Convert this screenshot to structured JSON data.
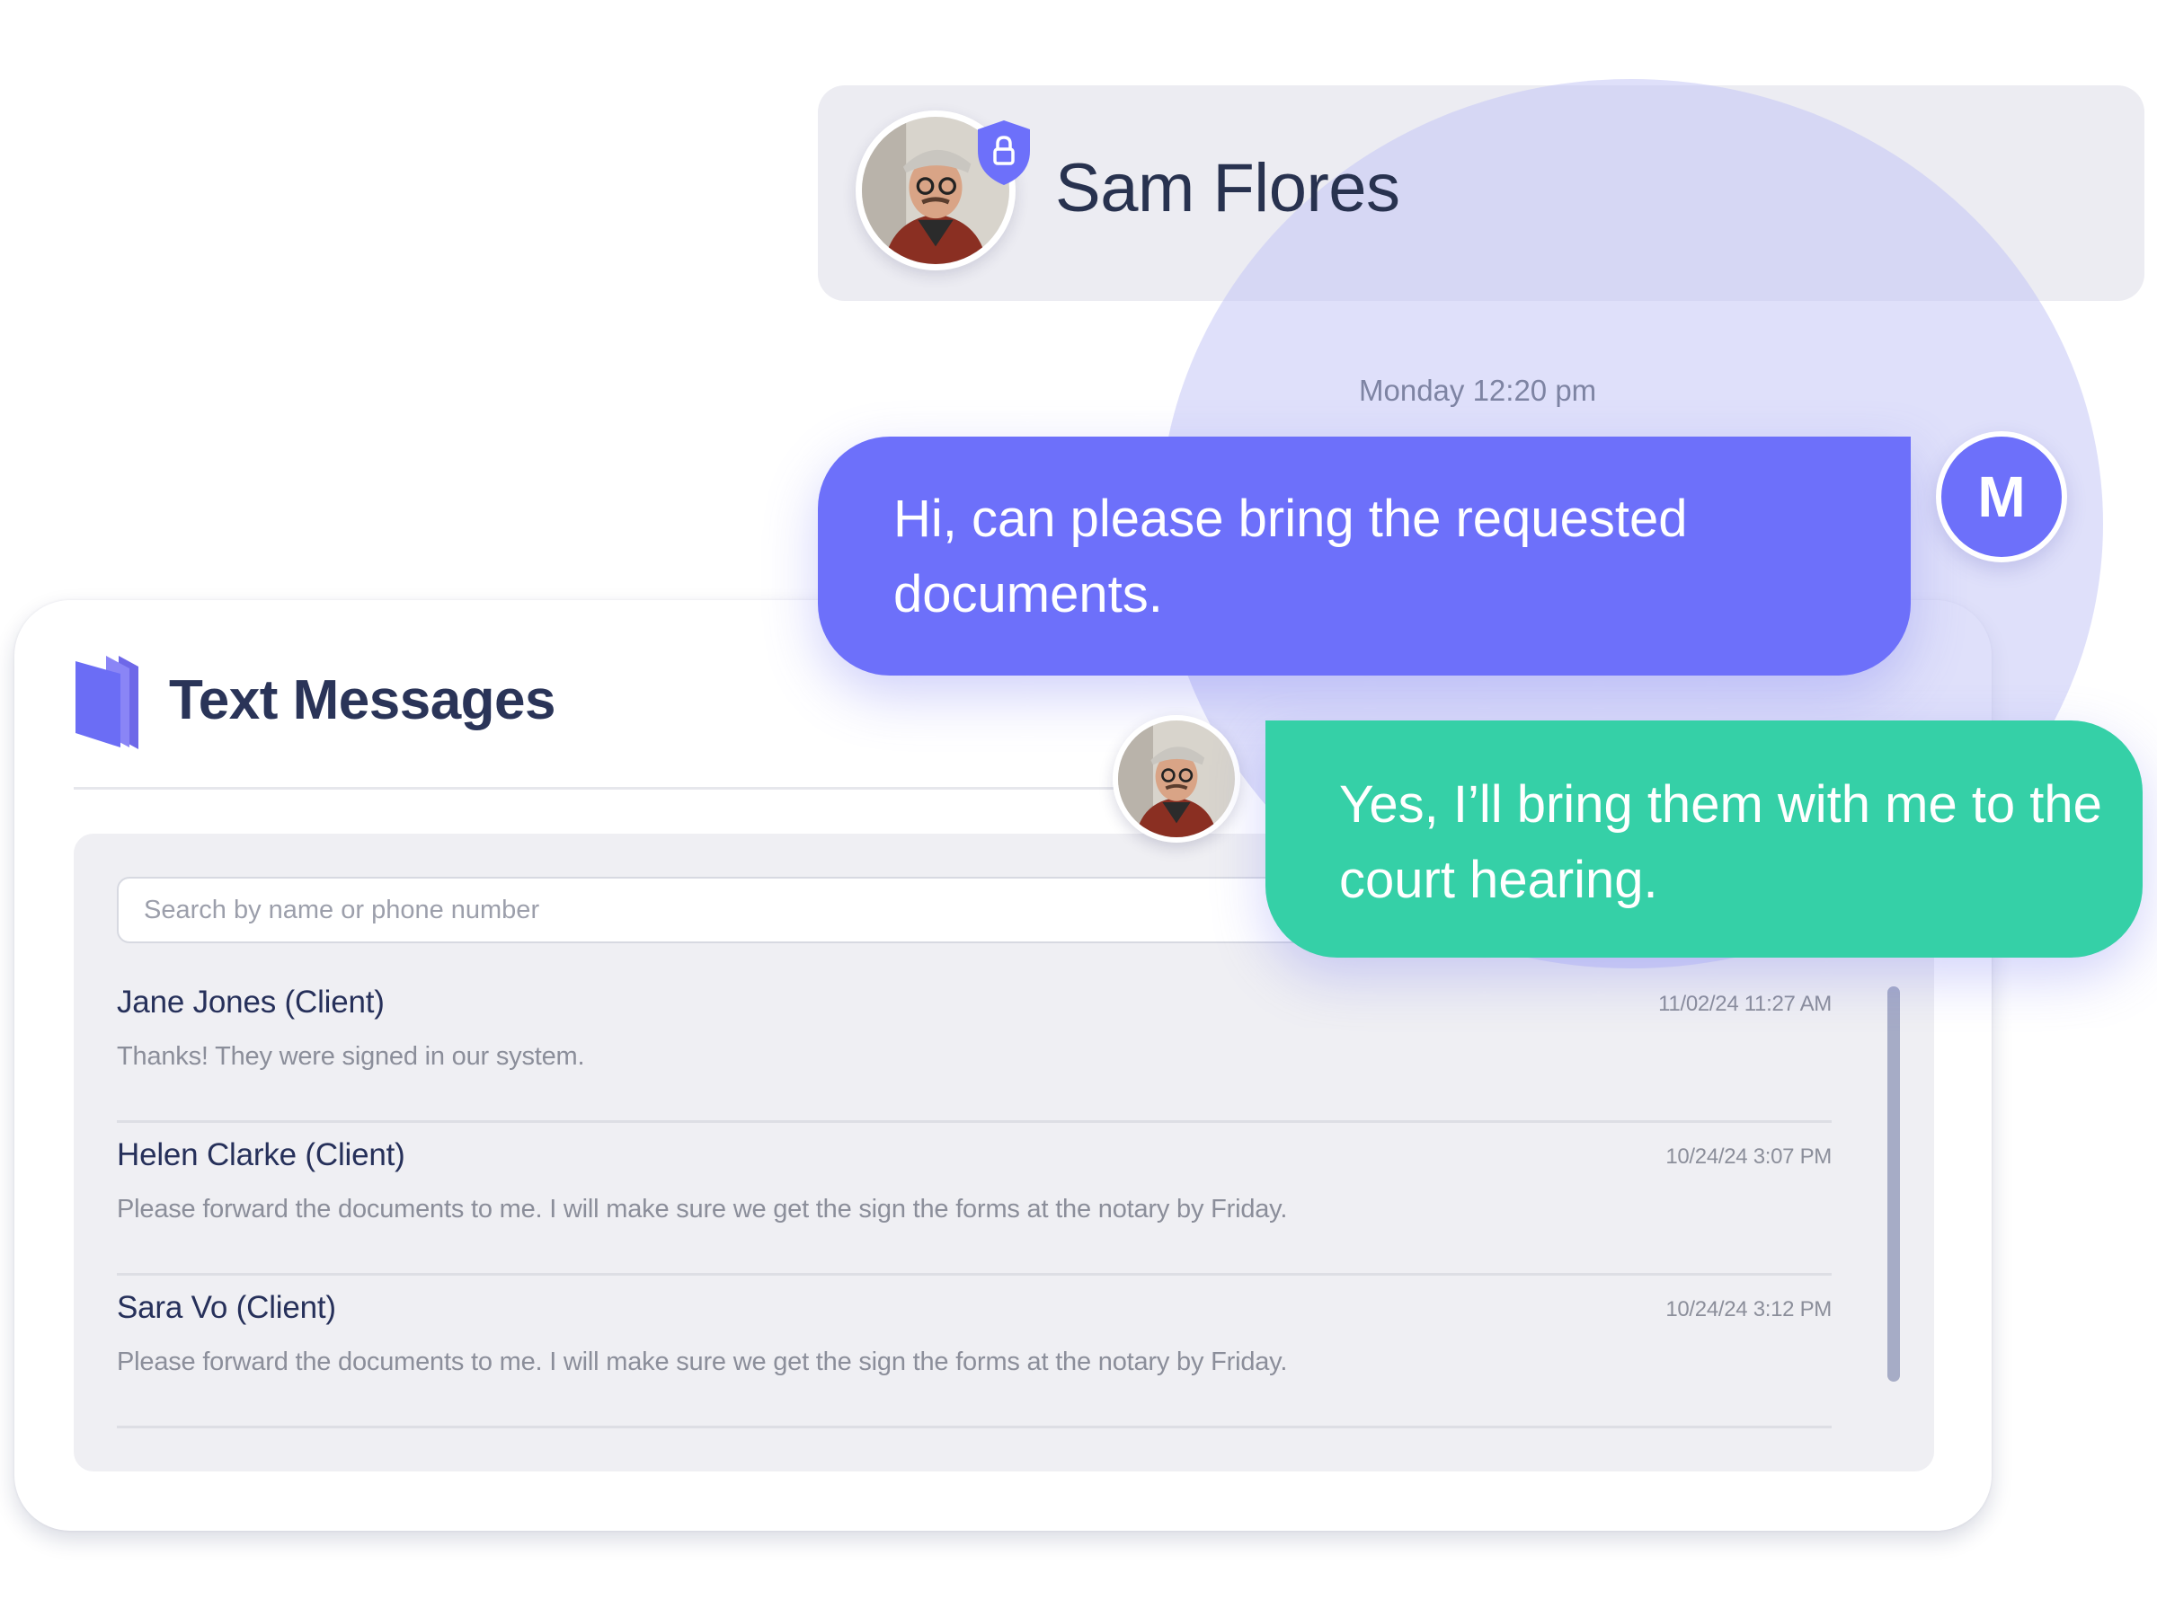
{
  "text_messages": {
    "title": "Text Messages",
    "search": {
      "placeholder": "Search by name or phone number",
      "value": ""
    },
    "conversations": [
      {
        "name": "Jane Jones (Client)",
        "time": "11/02/24 11:27 AM",
        "preview": "Thanks! They were signed in our system."
      },
      {
        "name": "Helen Clarke (Client)",
        "time": "10/24/24 3:07 PM",
        "preview": "Please forward the documents to me. I will make sure we get the sign the forms at the notary by Friday."
      },
      {
        "name": "Sara Vo (Client)",
        "time": "10/24/24 3:12 PM",
        "preview": "Please forward the documents to me. I will make sure we get the sign the forms at the notary by Friday."
      }
    ]
  },
  "chat": {
    "contact_name": "Sam Flores",
    "timestamp": "Monday 12:20 pm",
    "outgoing_message": "Hi, can please bring the requested documents.",
    "user_initial": "M",
    "incoming_message": "Yes, I’ll bring them with me to the court hearing."
  },
  "icons": {
    "logo": "stacked-pages-logo",
    "secure": "shield-lock-icon"
  },
  "colors": {
    "accent": "#6d70fa",
    "incoming_bubble": "#35d0a7",
    "heading": "#2a3458",
    "muted": "#8b8e9a"
  }
}
